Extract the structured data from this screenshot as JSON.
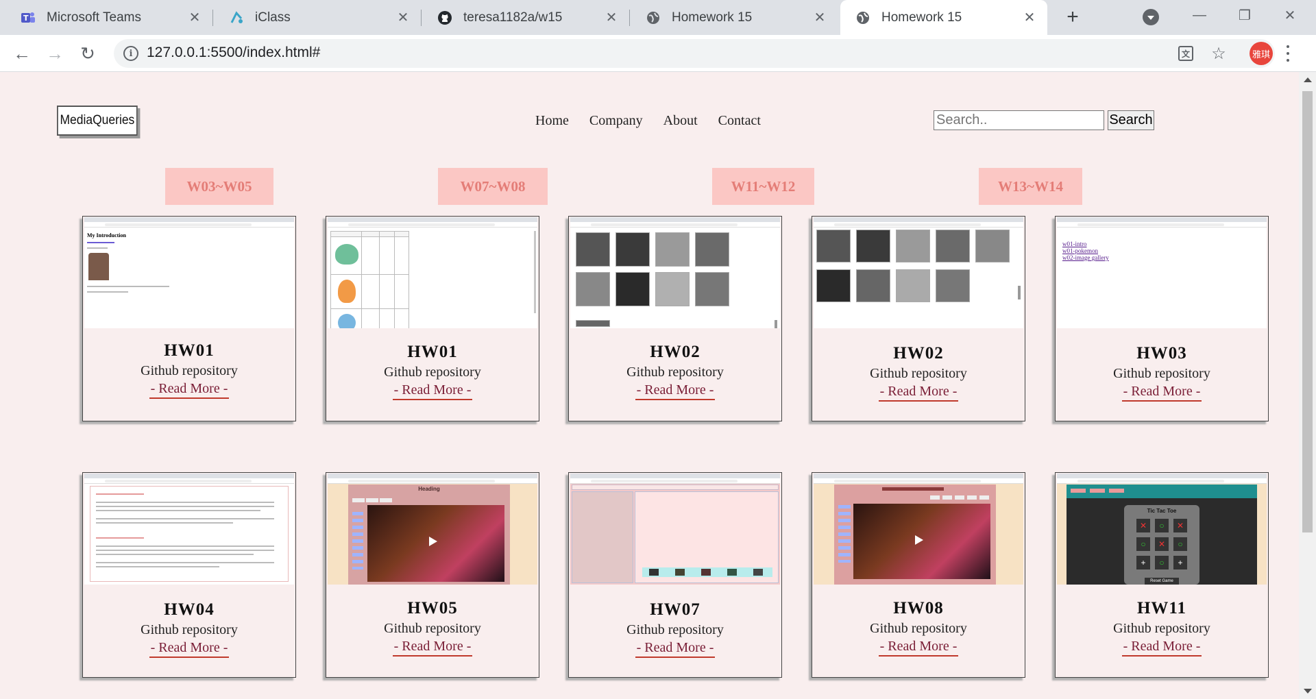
{
  "browser": {
    "tabs": [
      {
        "label": "Microsoft Teams",
        "icon": "teams-icon"
      },
      {
        "label": "iClass",
        "icon": "iclass-icon"
      },
      {
        "label": "teresa1182a/w15",
        "icon": "github-icon"
      },
      {
        "label": "Homework 15",
        "icon": "globe-icon"
      },
      {
        "label": "Homework 15",
        "icon": "globe-icon"
      }
    ],
    "url": "127.0.0.1:5500/index.html#",
    "avatar_text": "雅琪"
  },
  "page": {
    "brand": "MediaQueries",
    "nav": [
      "Home",
      "Company",
      "About",
      "Contact"
    ],
    "search": {
      "placeholder": "Search..",
      "button": "Search"
    },
    "weeks": [
      "W03~W05",
      "W07~W08",
      "W11~W12",
      "W13~W14"
    ],
    "cards": [
      {
        "title": "HW01",
        "repo": "Github repository",
        "more": "- Read More -"
      },
      {
        "title": "HW01",
        "repo": "Github repository",
        "more": "- Read More -"
      },
      {
        "title": "HW02",
        "repo": "Github repository",
        "more": "- Read More -"
      },
      {
        "title": "HW02",
        "repo": "Github repository",
        "more": "- Read More -"
      },
      {
        "title": "HW03",
        "repo": "Github repository",
        "more": "- Read More -"
      },
      {
        "title": "HW04",
        "repo": "Github repository",
        "more": "- Read More -"
      },
      {
        "title": "HW05",
        "repo": "Github repository",
        "more": "- Read More -"
      },
      {
        "title": "HW07",
        "repo": "Github repository",
        "more": "- Read More -"
      },
      {
        "title": "HW08",
        "repo": "Github repository",
        "more": "- Read More -"
      },
      {
        "title": "HW11",
        "repo": "Github repository",
        "more": "- Read More -"
      }
    ],
    "thumbs": {
      "hw01a": {
        "heading": "My Introduction"
      },
      "hw03": {
        "links": [
          "w01-intro",
          "w01-pokemon",
          "w02-image gallery"
        ]
      },
      "hw05": {
        "heading": "Heading"
      },
      "hw11": {
        "heading": "Tic Tac Toe",
        "reset": "Reset Game"
      }
    }
  },
  "colors": {
    "page_bg": "#f9eeee",
    "week_bg": "#fbc7c4",
    "week_text": "#e47d77",
    "link": "#7a1e36"
  }
}
